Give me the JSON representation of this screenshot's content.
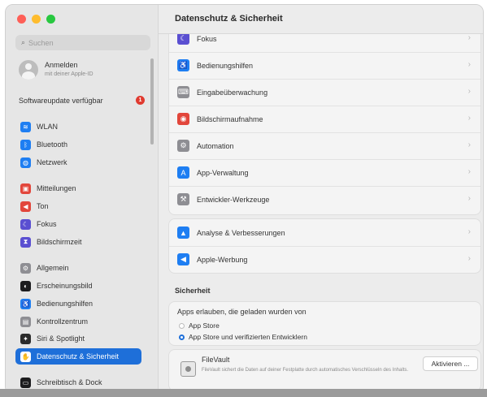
{
  "window_title": "Datenschutz & Sicherheit",
  "sidebar": {
    "search_placeholder": "Suchen",
    "account": {
      "line1": "Anmelden",
      "line2": "mit deiner Apple-ID"
    },
    "update": {
      "label": "Softwareupdate verfügbar",
      "badge": "1"
    },
    "items": [
      {
        "label": "WLAN",
        "icon": "wifi-icon",
        "color": "#1e7ef2",
        "glyph": "≋"
      },
      {
        "label": "Bluetooth",
        "icon": "bluetooth-icon",
        "color": "#1e7ef2",
        "glyph": "ᛒ"
      },
      {
        "label": "Netzwerk",
        "icon": "globe-icon",
        "color": "#1e7ef2",
        "glyph": "◍"
      },
      {
        "label": "Mitteilungen",
        "icon": "notifications-icon",
        "color": "#e2463b",
        "glyph": "▣"
      },
      {
        "label": "Ton",
        "icon": "sound-icon",
        "color": "#e2463b",
        "glyph": "◀"
      },
      {
        "label": "Fokus",
        "icon": "moon-icon",
        "color": "#5a4fd1",
        "glyph": "☾"
      },
      {
        "label": "Bildschirmzeit",
        "icon": "hourglass-icon",
        "color": "#5a4fd1",
        "glyph": "⧗"
      },
      {
        "label": "Allgemein",
        "icon": "gear-icon",
        "color": "#8e8e93",
        "glyph": "⚙"
      },
      {
        "label": "Erscheinungsbild",
        "icon": "appearance-icon",
        "color": "#1c1c1e",
        "glyph": "◐"
      },
      {
        "label": "Bedienungshilfen",
        "icon": "accessibility-icon",
        "color": "#1e7ef2",
        "glyph": "♿"
      },
      {
        "label": "Kontrollzentrum",
        "icon": "control-center-icon",
        "color": "#8e8e93",
        "glyph": "▤"
      },
      {
        "label": "Siri & Spotlight",
        "icon": "siri-icon",
        "color": "#2b2b2b",
        "glyph": "✦"
      },
      {
        "label": "Datenschutz & Sicherheit",
        "icon": "hand-icon",
        "color": "#1e7ef2",
        "glyph": "✋"
      },
      {
        "label": "Schreibtisch & Dock",
        "icon": "dock-icon",
        "color": "#1c1c1e",
        "glyph": "▭"
      }
    ]
  },
  "main": {
    "group1": [
      {
        "label": "Fokus",
        "icon": "moon-icon",
        "color": "#5a4fd1",
        "glyph": "☾"
      },
      {
        "label": "Bedienungshilfen",
        "icon": "accessibility-icon",
        "color": "#1e7ef2",
        "glyph": "♿"
      },
      {
        "label": "Eingabeüberwachung",
        "icon": "keyboard-icon",
        "color": "#8e8e93",
        "glyph": "⌨"
      },
      {
        "label": "Bildschirmaufnahme",
        "icon": "screen-record-icon",
        "color": "#e2463b",
        "glyph": "◉"
      },
      {
        "label": "Automation",
        "icon": "automation-icon",
        "color": "#8e8e93",
        "glyph": "⚙"
      },
      {
        "label": "App-Verwaltung",
        "icon": "app-store-icon",
        "color": "#1e7ef2",
        "glyph": "A"
      },
      {
        "label": "Entwickler-Werkzeuge",
        "icon": "developer-tools-icon",
        "color": "#8e8e93",
        "glyph": "⚒"
      }
    ],
    "group2": [
      {
        "label": "Analyse & Verbesserungen",
        "icon": "analytics-icon",
        "color": "#1e7ef2",
        "glyph": "▲"
      },
      {
        "label": "Apple-Werbung",
        "icon": "megaphone-icon",
        "color": "#1e7ef2",
        "glyph": "◀"
      }
    ],
    "chevron": "›",
    "security": {
      "title": "Sicherheit",
      "apps_label": "Apps erlauben, die geladen wurden von",
      "option1": "App Store",
      "option2": "App Store und verifizierten Entwicklern",
      "selected": 2
    },
    "filevault": {
      "name": "FileVault",
      "description": "FileVault sichert die Daten auf deiner Festplatte durch automatisches Verschlüsseln des Inhalts.",
      "button": "Aktivieren ..."
    }
  }
}
